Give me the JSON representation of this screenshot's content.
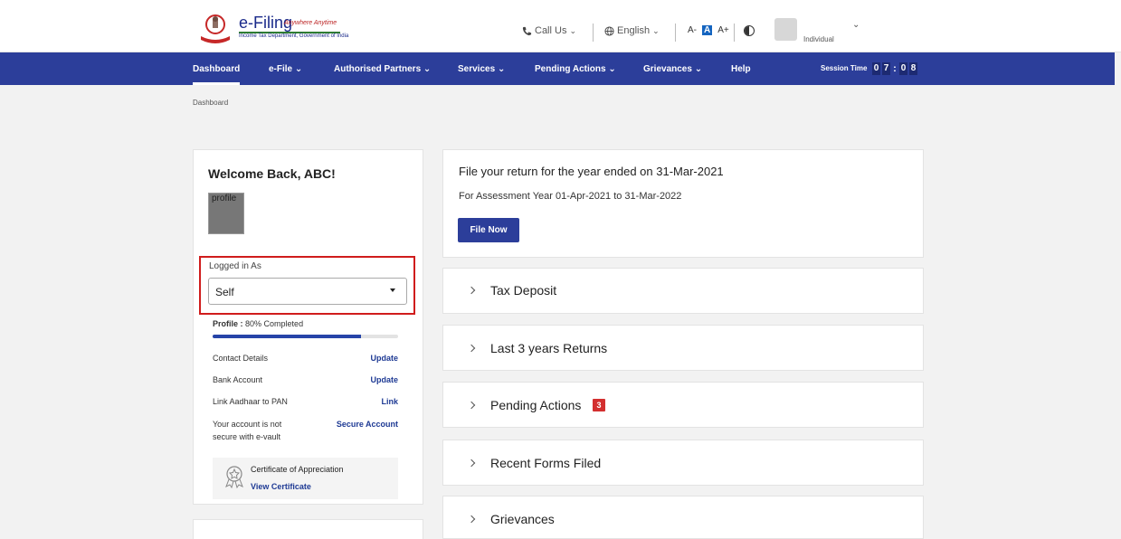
{
  "header": {
    "logo_title": "e-Filing",
    "logo_tagline": "Anywhere Anytime",
    "logo_subtitle": "Income Tax Department, Government of India",
    "call_us": "Call Us",
    "language": "English",
    "font_small": "A-",
    "font_normal": "A",
    "font_large": "A+",
    "user_type": "Individual"
  },
  "nav": {
    "items": [
      "Dashboard",
      "e-File",
      "Authorised Partners",
      "Services",
      "Pending Actions",
      "Grievances",
      "Help"
    ],
    "active": "Dashboard",
    "session_label": "Session Time",
    "timer_digits": [
      "0",
      "7",
      "0",
      "8"
    ]
  },
  "breadcrumb": "Dashboard",
  "profile_card": {
    "welcome": "Welcome Back,  ABC!",
    "profile_img_alt": "profile",
    "logged_in_label": "Logged in As",
    "logged_in_value": "Self",
    "profile_status_label": "Profile :",
    "profile_status_value": "80% Completed",
    "profile_progress": 0.8,
    "rows": [
      {
        "label": "Contact Details",
        "link": "Update"
      },
      {
        "label": "Bank Account",
        "link": "Update"
      },
      {
        "label": "Link Aadhaar to PAN",
        "link": "Link"
      },
      {
        "label_line1": "Your account is not",
        "label_line2": "secure with e-vault",
        "link": "Secure Account"
      }
    ],
    "certificate_title": "Certificate of Appreciation",
    "certificate_link": "View Certificate"
  },
  "file_return": {
    "title": "File your return for the year ended on 31-Mar-2021",
    "subtitle": "For Assessment Year 01-Apr-2021 to 31-Mar-2022",
    "button": "File Now"
  },
  "accordions": [
    {
      "title": "Tax Deposit"
    },
    {
      "title": "Last 3 years Returns"
    },
    {
      "title": "Pending Actions",
      "badge": "3"
    },
    {
      "title": "Recent Forms Filed"
    },
    {
      "title": "Grievances"
    }
  ],
  "colors": {
    "nav_bg": "#2c3e9a",
    "highlight_box": "#d01c1c",
    "badge": "#d32f2f",
    "link": "#1e3a94"
  }
}
